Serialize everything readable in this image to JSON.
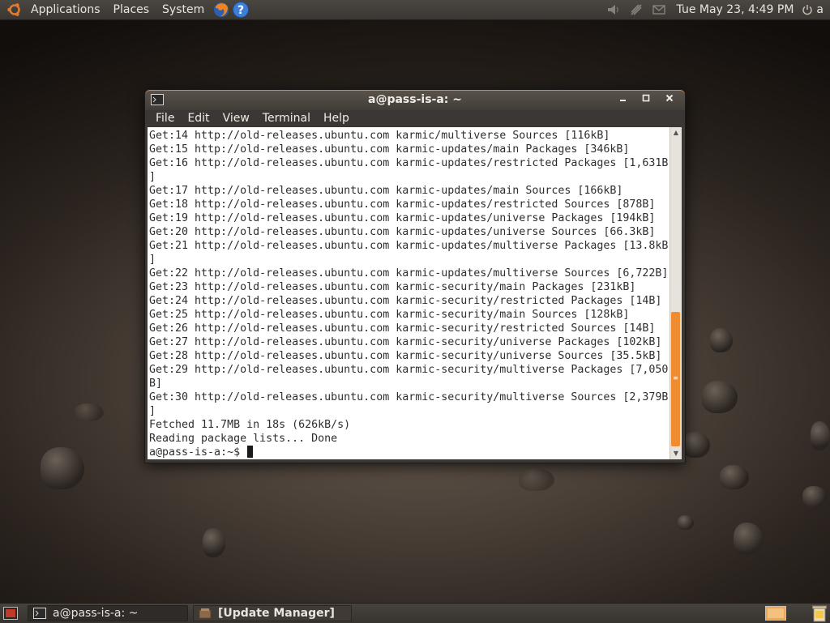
{
  "top_panel": {
    "menus": [
      "Applications",
      "Places",
      "System"
    ],
    "clock": "Tue May 23,  4:49 PM",
    "user": "a"
  },
  "terminal": {
    "title": "a@pass-is-a: ~",
    "menu": [
      "File",
      "Edit",
      "View",
      "Terminal",
      "Help"
    ],
    "lines": [
      "Get:14 http://old-releases.ubuntu.com karmic/multiverse Sources [116kB]",
      "Get:15 http://old-releases.ubuntu.com karmic-updates/main Packages [346kB]",
      "Get:16 http://old-releases.ubuntu.com karmic-updates/restricted Packages [1,631B",
      "]",
      "Get:17 http://old-releases.ubuntu.com karmic-updates/main Sources [166kB]",
      "Get:18 http://old-releases.ubuntu.com karmic-updates/restricted Sources [878B]",
      "Get:19 http://old-releases.ubuntu.com karmic-updates/universe Packages [194kB]",
      "Get:20 http://old-releases.ubuntu.com karmic-updates/universe Sources [66.3kB]",
      "Get:21 http://old-releases.ubuntu.com karmic-updates/multiverse Packages [13.8kB",
      "]",
      "Get:22 http://old-releases.ubuntu.com karmic-updates/multiverse Sources [6,722B]",
      "Get:23 http://old-releases.ubuntu.com karmic-security/main Packages [231kB]",
      "Get:24 http://old-releases.ubuntu.com karmic-security/restricted Packages [14B]",
      "Get:25 http://old-releases.ubuntu.com karmic-security/main Sources [128kB]",
      "Get:26 http://old-releases.ubuntu.com karmic-security/restricted Sources [14B]",
      "Get:27 http://old-releases.ubuntu.com karmic-security/universe Packages [102kB]",
      "Get:28 http://old-releases.ubuntu.com karmic-security/universe Sources [35.5kB]",
      "Get:29 http://old-releases.ubuntu.com karmic-security/multiverse Packages [7,050",
      "B]",
      "Get:30 http://old-releases.ubuntu.com karmic-security/multiverse Sources [2,379B",
      "]",
      "Fetched 11.7MB in 18s (626kB/s)",
      "Reading package lists... Done"
    ],
    "prompt": "a@pass-is-a:~$ "
  },
  "taskbar": {
    "terminal_task": "a@pass-is-a: ~",
    "update_task": "[Update Manager]"
  },
  "colors": {
    "accent_orange": "#f08c30",
    "panel_bg": "#3a3632",
    "terminal_bg": "#ffffff"
  },
  "icons": [
    "ubuntu-logo-icon",
    "firefox-icon",
    "help-icon",
    "volume-icon",
    "network-icon",
    "mail-icon",
    "power-icon",
    "terminal-icon",
    "minimize-icon",
    "maximize-icon",
    "close-icon",
    "show-desktop-icon",
    "update-manager-icon",
    "workspace-icon",
    "trash-icon"
  ]
}
